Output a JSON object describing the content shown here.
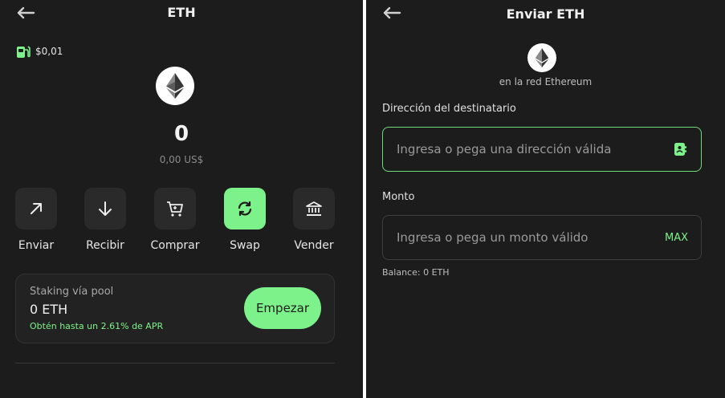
{
  "colors": {
    "background": "#1c1c1c",
    "accent": "#7ef28a",
    "button": "#2a2a2a",
    "muted": "#8a8a8a"
  },
  "left": {
    "title": "ETH",
    "back_icon": "arrow-left-icon",
    "gas_fee": "$0,01",
    "balance": {
      "amount": "0",
      "fiat": "0,00 US$"
    },
    "actions": [
      {
        "label": "Enviar",
        "icon": "arrow-up-right-icon"
      },
      {
        "label": "Recibir",
        "icon": "arrow-down-icon"
      },
      {
        "label": "Comprar",
        "icon": "cart-icon"
      },
      {
        "label": "Swap",
        "icon": "swap-icon"
      },
      {
        "label": "Vender",
        "icon": "bank-icon"
      }
    ],
    "staking": {
      "title": "Staking vía pool",
      "value": "0 ETH",
      "apr": "Obtén hasta un 2.61% de APR",
      "button": "Empezar"
    }
  },
  "right": {
    "title": "Enviar ETH",
    "back_icon": "arrow-left-icon",
    "network": "en la red Ethereum",
    "recipient": {
      "label": "Dirección del destinatario",
      "placeholder": "Ingresa o pega una dirección válida",
      "value": ""
    },
    "amount": {
      "label": "Monto",
      "placeholder": "Ingresa o pega un monto válido",
      "value": "",
      "max_label": "MAX"
    },
    "balance_label": "Balance:",
    "balance_value": "0 ETH"
  }
}
